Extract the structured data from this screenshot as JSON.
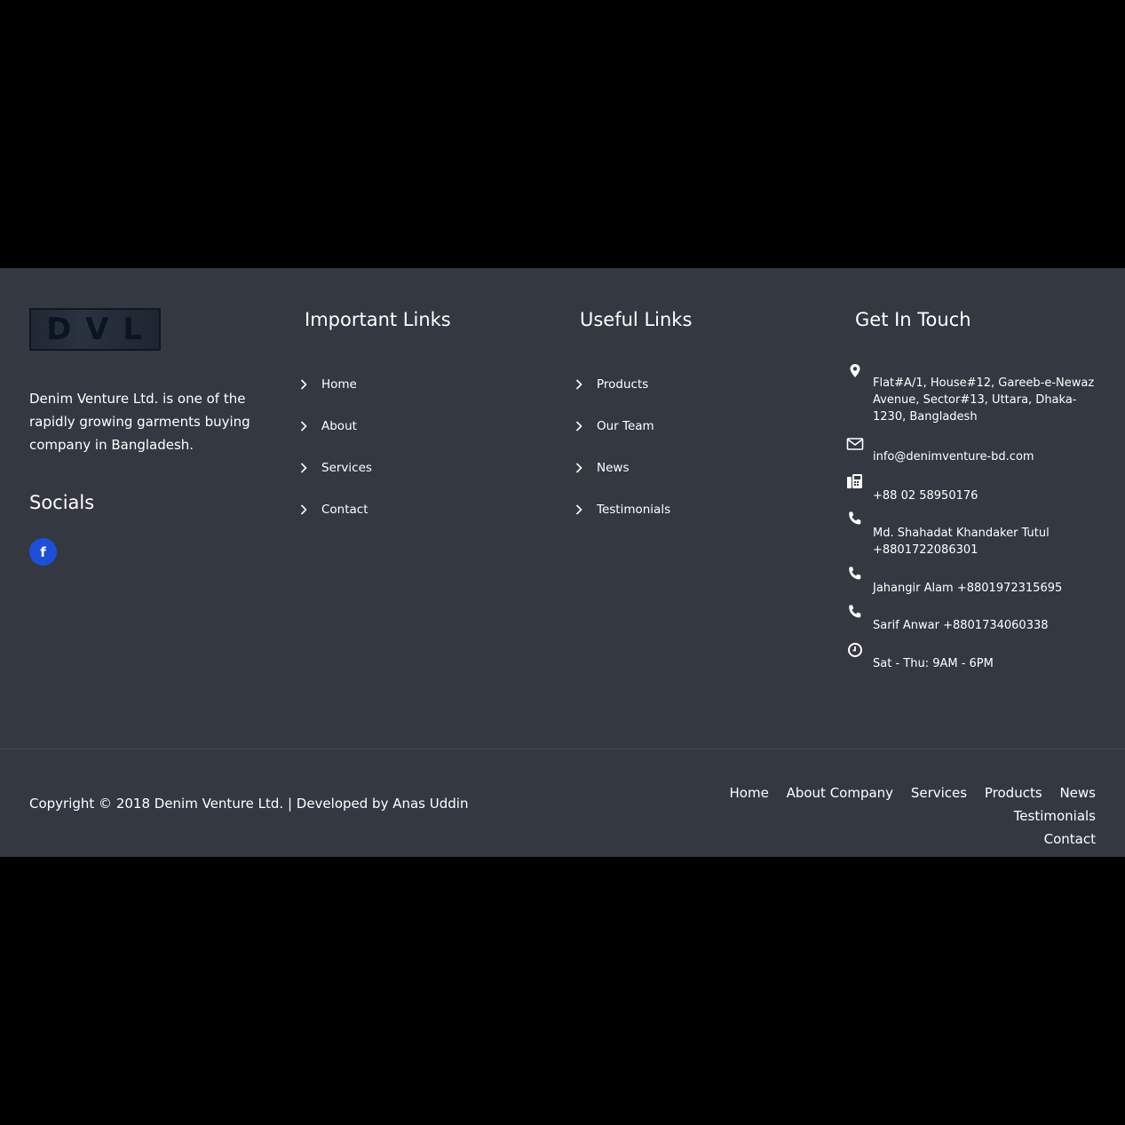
{
  "brand": {
    "logo_text": "D V L",
    "description": "Denim Venture Ltd. is one of the rapidly growing garments buying company in Bangladesh."
  },
  "socials": {
    "heading": "Socials",
    "facebook_icon": "facebook-icon",
    "facebook_letter": "f",
    "facebook_color": "#1d4fd8"
  },
  "important_links": {
    "heading": "Important Links",
    "items": [
      "Home",
      "About",
      "Services",
      "Contact"
    ]
  },
  "useful_links": {
    "heading": "Useful Links",
    "items": [
      "Products",
      "Our Team",
      "News",
      "Testimonials"
    ]
  },
  "contact": {
    "heading": "Get In Touch",
    "items": [
      {
        "icon": "map-pin-icon",
        "text": "Flat#A/1, House#12, Gareeb-e-Newaz Avenue, Sector#13, Uttara, Dhaka-1230, Bangladesh"
      },
      {
        "icon": "envelope-icon",
        "text": "info@denimventure-bd.com"
      },
      {
        "icon": "fax-icon",
        "text": "+88 02 58950176"
      },
      {
        "icon": "phone-icon",
        "text": "Md. Shahadat Khandaker Tutul +8801722086301"
      },
      {
        "icon": "phone-icon",
        "text": "Jahangir Alam +8801972315695"
      },
      {
        "icon": "phone-icon",
        "text": "Sarif Anwar +8801734060338"
      },
      {
        "icon": "clock-icon",
        "text": "Sat - Thu: 9AM - 6PM"
      }
    ]
  },
  "footer_bottom": {
    "copyright": "Copyright © 2018 Denim Venture Ltd. | Developed by Anas Uddin",
    "nav": [
      "Home",
      "About Company",
      "Services",
      "Products",
      "News",
      "Testimonials",
      "Contact"
    ]
  },
  "colors": {
    "page_background": "#000000",
    "footer_background": "#343840",
    "text": "#ffffff"
  }
}
